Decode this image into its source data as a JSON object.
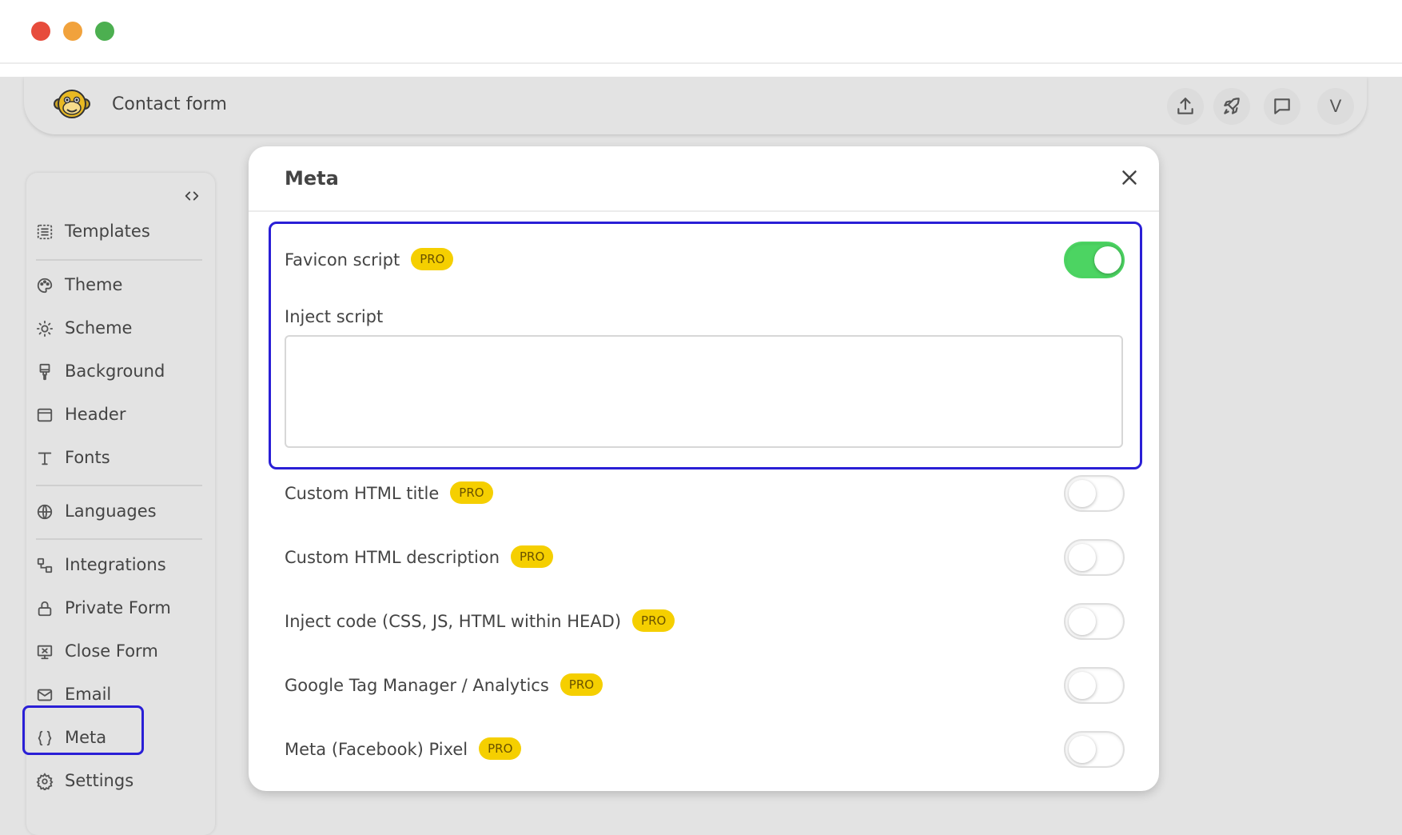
{
  "app": {
    "title": "Contact form",
    "user_initial": "V"
  },
  "sidebar": {
    "items": [
      {
        "label": "Templates"
      },
      {
        "label": "Theme"
      },
      {
        "label": "Scheme"
      },
      {
        "label": "Background"
      },
      {
        "label": "Header"
      },
      {
        "label": "Fonts"
      },
      {
        "label": "Languages"
      },
      {
        "label": "Integrations"
      },
      {
        "label": "Private Form"
      },
      {
        "label": "Close Form"
      },
      {
        "label": "Email"
      },
      {
        "label": "Meta"
      },
      {
        "label": "Settings"
      }
    ],
    "active": "Meta"
  },
  "modal": {
    "title": "Meta",
    "pro_label": "PRO",
    "favicon": {
      "label": "Favicon script",
      "enabled": true
    },
    "inject_script": {
      "label": "Inject script",
      "value": ""
    },
    "options": [
      {
        "label": "Custom HTML title",
        "enabled": false
      },
      {
        "label": "Custom HTML description",
        "enabled": false
      },
      {
        "label": "Inject code (CSS, JS, HTML within HEAD)",
        "enabled": false
      },
      {
        "label": "Google Tag Manager / Analytics",
        "enabled": false
      },
      {
        "label": "Meta (Facebook) Pixel",
        "enabled": false
      }
    ]
  },
  "colors": {
    "accent_toggle_on": "#4cd462",
    "pro_badge": "#f5cf00",
    "highlight": "#2a1fd6"
  }
}
